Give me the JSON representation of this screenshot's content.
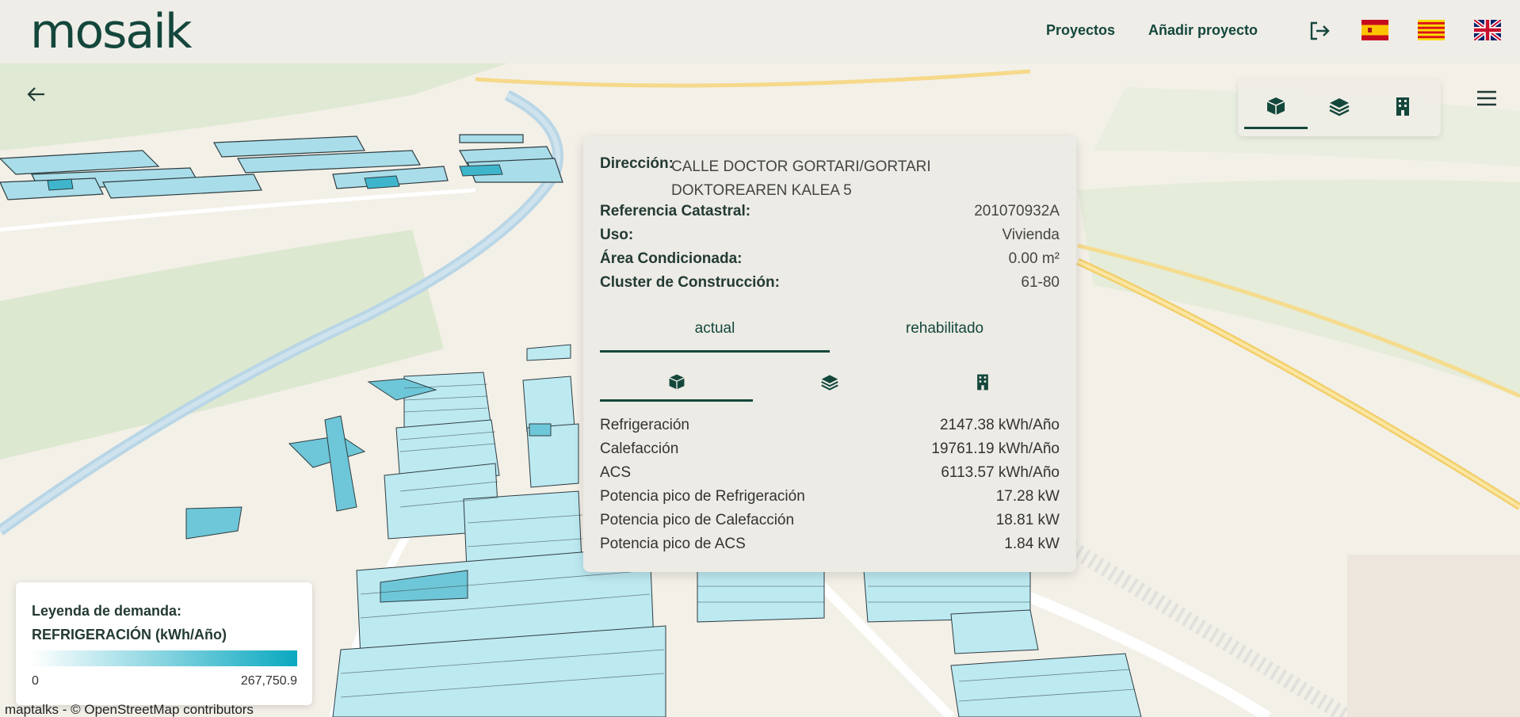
{
  "header": {
    "logo": "mosaik",
    "nav": [
      "Proyectos",
      "Añadir proyecto"
    ],
    "icons": [
      "logout-icon",
      "flag-es-icon",
      "flag-catalonia-icon",
      "flag-uk-icon"
    ]
  },
  "map_controls": {
    "back": "arrow-left-icon",
    "view_switch": [
      "cube-icon",
      "layers-icon",
      "building-icon"
    ],
    "menu": "hamburger-icon"
  },
  "info": {
    "direccion_label": "Dirección:",
    "direccion_value": "CALLE DOCTOR GORTARI/GORTARI DOKTOREAREN KALEA 5",
    "referencia_label": "Referencia Catastral:",
    "referencia_value": "201070932A",
    "uso_label": "Uso:",
    "uso_value": "Vivienda",
    "area_label": "Área Condicionada:",
    "area_value": "0.00 m²",
    "cluster_label": "Cluster de Construcción:",
    "cluster_value": "61-80",
    "tabs": [
      "actual",
      "rehabilitado"
    ],
    "metrics": [
      {
        "label": "Refrigeración",
        "value": "2147.38 kWh/Año"
      },
      {
        "label": "Calefacción",
        "value": "19761.19 kWh/Año"
      },
      {
        "label": "ACS",
        "value": "6113.57 kWh/Año"
      },
      {
        "label": "Potencia pico de Refrigeración",
        "value": "17.28 kW"
      },
      {
        "label": "Potencia pico de Calefacción",
        "value": "18.81 kW"
      },
      {
        "label": "Potencia pico de ACS",
        "value": "1.84 kW"
      }
    ]
  },
  "legend": {
    "title": "Leyenda de demanda:",
    "subtitle": "REFRIGERACIÓN (kWh/Año)",
    "min": "0",
    "max": "267,750.9",
    "color_low": "#ffffff",
    "color_high": "#0aa8c0"
  },
  "attribution": "maptalks - © OpenStreetMap contributors",
  "colors": {
    "brand": "#14473c",
    "building": "#bde9f1",
    "building_dark": "#3fb5cc"
  }
}
